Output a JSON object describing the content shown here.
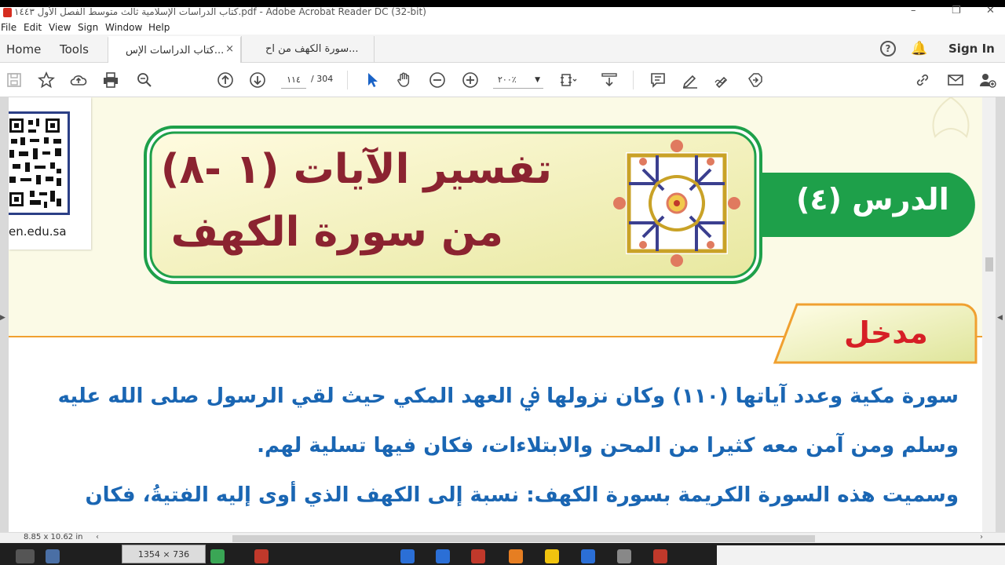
{
  "window": {
    "title": "كتاب الدراسات الإسلامية ثالث متوسط الفصل الأول ١٤٤٣.pdf - Adobe Acrobat Reader DC (32-bit)"
  },
  "menu": [
    "File",
    "Edit",
    "View",
    "Sign",
    "Window",
    "Help"
  ],
  "tabs": {
    "home": "Home",
    "tools": "Tools",
    "doc1": "كتاب الدراسات الإس...",
    "doc2": "سورة الكهف من اح...",
    "close": "×",
    "signin": "Sign In",
    "help": "?"
  },
  "toolbar": {
    "current_page": "١١٤",
    "total_pages": "/ 304",
    "zoom": "٢٠٠٪"
  },
  "page": {
    "url_fragment": "en.edu.sa",
    "heading_line1": "تفسير الآيات (١ -٨)",
    "heading_line2": "من سورة الكهف",
    "lesson": "الدرس (٤)",
    "intro": "مدخل",
    "body": [
      "سورة مكية وعدد آياتها (١١٠) وكان نزولها ﰲ العهد المكي حيث لقي الرسول صلى الله عليه",
      "وسلم ومن آمن معه كثيرا من المحن والابتلاءات، فكان فيها تسلية لهم.",
      "وسميت هذه السورة الكريمة بسورة الكهف: نسبة إلى الكهف الذي أوى إليه الفتيةُ، فكان"
    ]
  },
  "status": {
    "page_size": "8.85 x 10.62 in"
  },
  "taskbar": {
    "resolution": "1354 × 736"
  },
  "colors": {
    "heading": "#8b2330",
    "body_text": "#1a66b3",
    "lesson_band": "#1ea04a",
    "intro_text": "#d61f26",
    "accent_orange": "#f0a030"
  }
}
